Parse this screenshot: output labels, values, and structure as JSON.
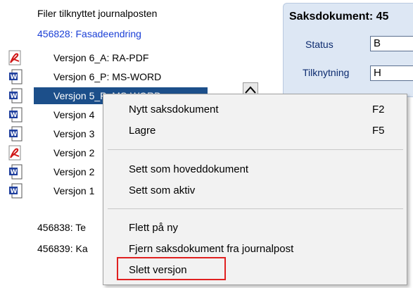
{
  "file_panel": {
    "header": "Filer tilknyttet journalposten",
    "rows": [
      {
        "label": "456828: Fasadeendring",
        "icon": "none",
        "link": true
      },
      {
        "label": "Versjon 6_A: RA-PDF",
        "icon": "pdf-icon"
      },
      {
        "label": "Versjon 6_P: MS-WORD",
        "icon": "word-icon"
      },
      {
        "label": "Versjon 5_P: MS-WORD",
        "icon": "word-icon",
        "selected": true
      },
      {
        "label": "Versjon 4",
        "icon": "word-icon"
      },
      {
        "label": "Versjon 3",
        "icon": "word-icon"
      },
      {
        "label": "Versjon 2",
        "icon": "pdf-icon"
      },
      {
        "label": "Versjon 2",
        "icon": "word-icon"
      },
      {
        "label": "Versjon 1",
        "icon": "word-icon"
      },
      {
        "label": "456838: Te",
        "icon": "none"
      },
      {
        "label": "456839: Ka",
        "icon": "none"
      }
    ]
  },
  "right_panel": {
    "title": "Saksdokument: 45",
    "status_label": "Status",
    "status_value": "B",
    "tilknytning_label": "Tilknytning",
    "tilknytning_value": "H"
  },
  "context_menu": {
    "items": [
      {
        "label": "Nytt saksdokument",
        "shortcut": "F2"
      },
      {
        "label": "Lagre",
        "shortcut": "F5"
      },
      {
        "label": "Sett som hoveddokument",
        "shortcut": ""
      },
      {
        "label": "Sett som aktiv",
        "shortcut": ""
      },
      {
        "label": "Flett på ny",
        "shortcut": ""
      },
      {
        "label": "Fjern saksdokument fra journalpost",
        "shortcut": ""
      },
      {
        "label": "Slett versjon",
        "shortcut": "",
        "highlighted_box": true
      }
    ]
  },
  "colors": {
    "selection": "#1c4f8a",
    "link": "#1a3fd6",
    "highlight_box": "#e02020"
  }
}
